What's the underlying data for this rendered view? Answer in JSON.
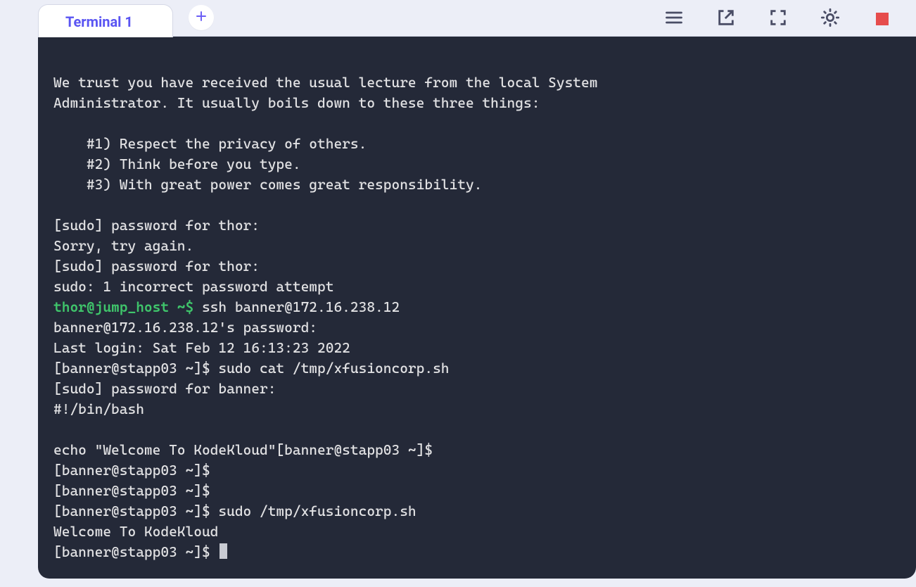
{
  "tab": {
    "label": "Terminal 1"
  },
  "terminal": {
    "lines": [
      {
        "segments": [
          {
            "text": ""
          }
        ]
      },
      {
        "segments": [
          {
            "text": "We trust you have received the usual lecture from the local System"
          }
        ]
      },
      {
        "segments": [
          {
            "text": "Administrator. It usually boils down to these three things:"
          }
        ]
      },
      {
        "segments": [
          {
            "text": ""
          }
        ]
      },
      {
        "segments": [
          {
            "text": "    #1) Respect the privacy of others."
          }
        ]
      },
      {
        "segments": [
          {
            "text": "    #2) Think before you type."
          }
        ]
      },
      {
        "segments": [
          {
            "text": "    #3) With great power comes great responsibility."
          }
        ]
      },
      {
        "segments": [
          {
            "text": ""
          }
        ]
      },
      {
        "segments": [
          {
            "text": "[sudo] password for thor: "
          }
        ]
      },
      {
        "segments": [
          {
            "text": "Sorry, try again."
          }
        ]
      },
      {
        "segments": [
          {
            "text": "[sudo] password for thor: "
          }
        ]
      },
      {
        "segments": [
          {
            "text": "sudo: 1 incorrect password attempt"
          }
        ]
      },
      {
        "segments": [
          {
            "text": "thor@jump_host ~$",
            "cls": "green"
          },
          {
            "text": " ssh banner@172.16.238.12"
          }
        ]
      },
      {
        "segments": [
          {
            "text": "banner@172.16.238.12's password: "
          }
        ]
      },
      {
        "segments": [
          {
            "text": "Last login: Sat Feb 12 16:13:23 2022"
          }
        ]
      },
      {
        "segments": [
          {
            "text": "[banner@stapp03 ~]$ sudo cat /tmp/xfusioncorp.sh"
          }
        ]
      },
      {
        "segments": [
          {
            "text": "[sudo] password for banner: "
          }
        ]
      },
      {
        "segments": [
          {
            "text": "#!/bin/bash"
          }
        ]
      },
      {
        "segments": [
          {
            "text": ""
          }
        ]
      },
      {
        "segments": [
          {
            "text": "echo \"Welcome To KodeKloud\"[banner@stapp03 ~]$ "
          }
        ]
      },
      {
        "segments": [
          {
            "text": "[banner@stapp03 ~]$ "
          }
        ]
      },
      {
        "segments": [
          {
            "text": "[banner@stapp03 ~]$ "
          }
        ]
      },
      {
        "segments": [
          {
            "text": "[banner@stapp03 ~]$ sudo /tmp/xfusioncorp.sh"
          }
        ]
      },
      {
        "segments": [
          {
            "text": "Welcome To KodeKloud"
          }
        ]
      },
      {
        "segments": [
          {
            "text": "[banner@stapp03 ~]$ "
          }
        ],
        "cursor": true
      }
    ]
  }
}
